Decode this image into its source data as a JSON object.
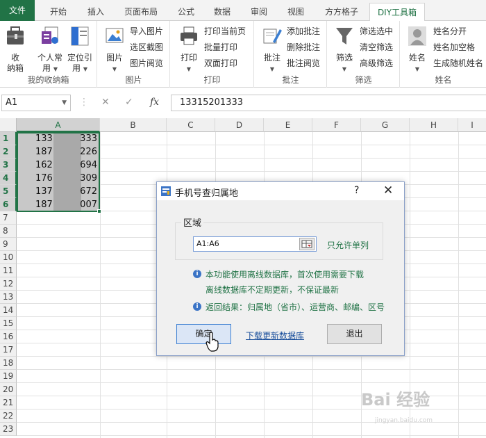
{
  "ribbon": {
    "tabs": [
      "文件",
      "开始",
      "插入",
      "页面布局",
      "公式",
      "数据",
      "审阅",
      "视图",
      "方方格子",
      "DIY工具箱"
    ],
    "active_tab": "DIY工具箱",
    "groups": {
      "favorites": {
        "label": "我的收纳箱",
        "btn_box": "收\n纳箱",
        "btn_personal": "个人常\n用",
        "btn_locate": "定位引\n用"
      },
      "image": {
        "label": "图片",
        "btn_image": "图片",
        "import": "导入图片",
        "capture": "选区截图",
        "view": "图片阅览"
      },
      "print": {
        "label": "打印",
        "btn_print": "打印",
        "print_page": "打印当前页",
        "batch": "批量打印",
        "duplex": "双面打印"
      },
      "comment": {
        "label": "批注",
        "btn_comment": "批注",
        "add": "添加批注",
        "delete": "删除批注",
        "view": "批注阅览"
      },
      "filter": {
        "label": "筛选",
        "btn_filter": "筛选",
        "filter_in": "筛选选中",
        "clear": "清空筛选",
        "advanced": "高级筛选"
      },
      "name": {
        "label": "姓名",
        "btn_name": "姓名",
        "split": "姓名分开",
        "space": "姓名加空格",
        "random": "生成随机姓名"
      }
    }
  },
  "formula_bar": {
    "name_box": "A1",
    "fx": "fx",
    "value": "13315201333"
  },
  "grid": {
    "columns": [
      "A",
      "B",
      "C",
      "D",
      "E",
      "F",
      "G",
      "H",
      "I"
    ],
    "rows": [
      "1",
      "2",
      "3",
      "4",
      "5",
      "6",
      "7",
      "8",
      "9",
      "10",
      "11",
      "12",
      "13",
      "14",
      "15",
      "16",
      "17",
      "18",
      "19",
      "20",
      "21",
      "22",
      "23"
    ],
    "cells": [
      {
        "left": "133",
        "right": "333"
      },
      {
        "left": "187",
        "right": "226"
      },
      {
        "left": "162",
        "right": "694"
      },
      {
        "left": "176",
        "right": "309"
      },
      {
        "left": "137",
        "right": "672"
      },
      {
        "left": "187",
        "right": "007"
      }
    ]
  },
  "dialog": {
    "title": "手机号查归属地",
    "help": "?",
    "close": "✕",
    "group_label": "区域",
    "range_value": "A1:A6",
    "only_single_col": "只允许单列",
    "info1": "本功能使用离线数据库，首次使用需要下载",
    "info1b": "离线数据库不定期更新，不保证最新",
    "info2": "返回结果：归属地（省市）、运营商、邮编、区号",
    "ok": "确定",
    "download": "下载更新数据库",
    "exit": "退出"
  },
  "watermark": {
    "logo": "Bai 经验",
    "sub": "jingyan.baidu.com"
  },
  "colors": {
    "excel_green": "#217346",
    "link": "#1a4f9c",
    "dialog_border": "#8aa0c8"
  }
}
